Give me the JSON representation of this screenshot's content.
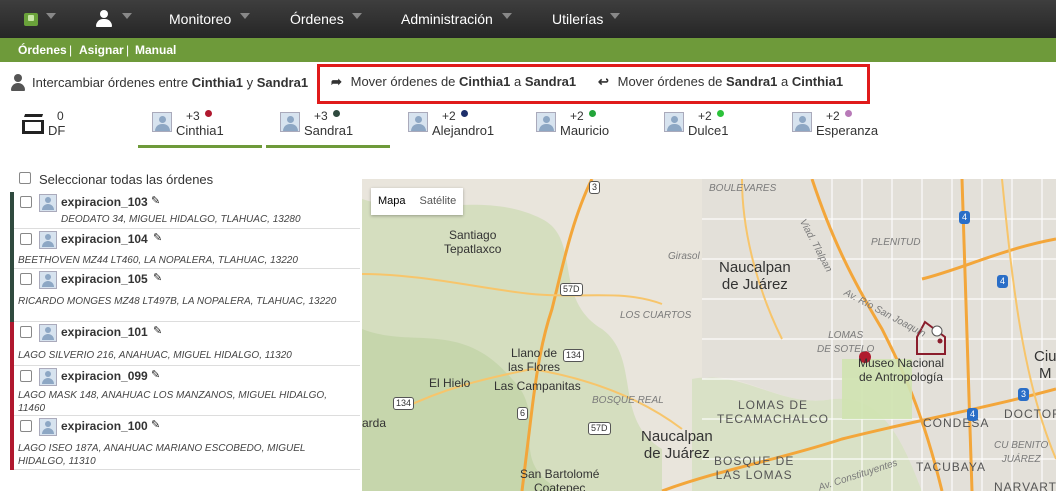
{
  "topnav": {
    "menus": [
      "Monitoreo",
      "Órdenes",
      "Administración",
      "Utilerías"
    ]
  },
  "subnav": {
    "items": [
      "Órdenes",
      "Asignar",
      "Manual"
    ],
    "separator": "|"
  },
  "swap": {
    "prefix": "Intercambiar órdenes entre",
    "agent_a": "Cinthia1",
    "conj": "y",
    "agent_b": "Sandra1",
    "move_prefix": "Mover órdenes de",
    "move_conj": "a",
    "move1_from": "Cinthia1",
    "move1_to": "Sandra1",
    "move2_from": "Sandra1",
    "move2_to": "Cinthia1"
  },
  "agents": [
    {
      "count": "0",
      "name": "DF",
      "dot": ""
    },
    {
      "count": "+3",
      "name": "Cinthia1",
      "dot": "#b0182e"
    },
    {
      "count": "+3",
      "name": "Sandra1",
      "dot": "#2f4a3e"
    },
    {
      "count": "+2",
      "name": "Alejandro1",
      "dot": "#1d2f6b"
    },
    {
      "count": "+2",
      "name": "Mauricio",
      "dot": "#23a53a"
    },
    {
      "count": "+2",
      "name": "Dulce1",
      "dot": "#2bc23a"
    },
    {
      "count": "+2",
      "name": "Esperanza",
      "dot": "#b87ab8"
    }
  ],
  "list": {
    "select_all": "Seleccionar todas las órdenes",
    "orders": [
      {
        "name": "expiracion_103",
        "address": "DEODATO 34, MIGUEL HIDALGO, TLAHUAC, 13280",
        "color": "#2f4a3e"
      },
      {
        "name": "expiracion_104",
        "address": "BEETHOVEN MZ44 LT460, LA NOPALERA, TLAHUAC, 13220",
        "color": "#2f4a3e"
      },
      {
        "name": "expiracion_105",
        "address": "RICARDO MONGES MZ48 LT497B, LA NOPALERA, TLAHUAC, 13220",
        "color": "#2f4a3e"
      },
      {
        "name": "expiracion_101",
        "address": "LAGO SILVERIO 216, ANAHUAC, MIGUEL HIDALGO, 11320",
        "color": "#b0182e"
      },
      {
        "name": "expiracion_099",
        "address": "LAGO MASK 148, ANAHUAC LOS MANZANOS, MIGUEL HIDALGO, 11460",
        "color": "#b0182e"
      },
      {
        "name": "expiracion_100",
        "address": "LAGO ISEO 187A, ANAHUAC MARIANO ESCOBEDO, MIGUEL HIDALGO, 11310",
        "color": "#b0182e"
      }
    ]
  },
  "map": {
    "tab_map": "Mapa",
    "tab_satellite": "Satélite",
    "labels": {
      "santiago": "Santiago\nTepatlaxco",
      "naucalpan1": "Naucalpan\nde Juárez",
      "naucalpan2": "Naucalpan\nde Juárez",
      "llano": "Llano de\nlas Flores",
      "campanitas": "Las Campanitas",
      "hielo": "El Hielo",
      "arda": "arda",
      "bartolome": "San Bartolomé\nCoatepec",
      "museo": "Museo Nacional\nde Antropología",
      "boulevares": "BOULEVARES",
      "lomas_tec": "LOMAS DE\nTECAMACHALCO",
      "bosque_lomas": "BOSQUE DE\nLAS LOMAS",
      "lomas_sotelo": "LOMAS\nDE SOTELO",
      "condesa": "CONDESA",
      "tacubaya": "TACUBAYA",
      "narvarte": "NARVARTE",
      "doctores": "DOCTOR",
      "ciu": "Ciu\nM",
      "plenitud": "PLENITUD",
      "cuartos": "LOS CUARTOS",
      "bosque_real": "BOSQUE REAL",
      "girasol": "Girasol",
      "tlalpan": "Viad. Tlalpan",
      "sanjoaquin": "Av. Río San Joaquín",
      "constituyentes": "Av. Constituyentes",
      "cubenito": "CU BENITO\nJUÁREZ",
      "hwy3": "3",
      "hwy57": "57D",
      "hwy57b": "57D",
      "hwy134": "134",
      "hwy134b": "134",
      "hwy6": "6",
      "hwy4a": "4",
      "hwy4b": "4",
      "hwy4c": "4",
      "hwy3b": "3"
    }
  }
}
